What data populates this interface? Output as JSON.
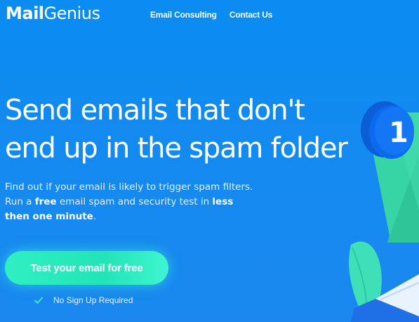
{
  "header": {
    "logo_part1": "Mail",
    "logo_part2": "Genius",
    "nav": [
      {
        "label": "Email Consulting"
      },
      {
        "label": "Contact Us"
      }
    ]
  },
  "hero": {
    "title_line1": "Send emails that don't",
    "title_line2": "end up in the spam folder",
    "desc_part1": "Find out if your email is likely to trigger spam filters. Run a ",
    "desc_bold1": "free",
    "desc_part2": " email spam and security test in ",
    "desc_bold2": "less then one minute",
    "desc_part3": "."
  },
  "cta": {
    "label": "Test your email for free"
  },
  "note": {
    "icon": "check-icon",
    "text": "No Sign Up Required"
  },
  "illustration": {
    "badge_number": "1",
    "icons": [
      "notification-badge-icon",
      "envelope-icon",
      "leaf-icon"
    ]
  },
  "colors": {
    "background": "#138af0",
    "cta": "#2ff0c2",
    "check": "#37e8c0"
  }
}
